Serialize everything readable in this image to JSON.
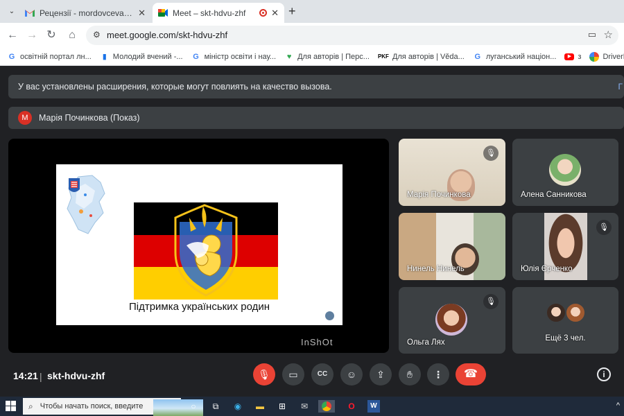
{
  "browser": {
    "tabs": [
      {
        "title": "Рецензії - mordovcevanv@gma",
        "active": false
      },
      {
        "title": "Meet – skt-hdvu-zhf",
        "active": true
      }
    ],
    "url": "meet.google.com/skt-hdvu-zhf",
    "bookmarks": [
      {
        "label": "освітній портал лн...",
        "icon": "google-g-icon"
      },
      {
        "label": "Молодий вчений -...",
        "icon": "bookmark-icon"
      },
      {
        "label": "міністр освіти і нау...",
        "icon": "google-g-icon"
      },
      {
        "label": "Для авторів | Перс...",
        "icon": "heart-icon"
      },
      {
        "label": "Для авторів | Věda...",
        "icon": "pkf-icon"
      },
      {
        "label": "луганський націон...",
        "icon": "google-g-icon"
      },
      {
        "label": "з",
        "icon": "youtube-icon"
      },
      {
        "label": "DriverPack",
        "icon": "driverpack-icon"
      }
    ]
  },
  "meet": {
    "banner": "У вас установлены расширения, которые могут повлиять на качество вызова.",
    "banner_more": "Г",
    "presenter": {
      "avatar_letter": "М",
      "name": "Марія Починкова (Показ)"
    },
    "slide": {
      "caption": "Підтримка українських родин",
      "watermark": "InShOt"
    },
    "participants": [
      {
        "name": "Марія Починкова",
        "muted": true
      },
      {
        "name": "Алена Санникова",
        "muted": false
      },
      {
        "name": "Нинель Нинель",
        "muted": false
      },
      {
        "name": "Юлія Єрченко",
        "muted": true
      },
      {
        "name": "Ольга Лях",
        "muted": true
      },
      {
        "name": "Ещё 3 чел.",
        "muted": false
      }
    ],
    "footer": {
      "time": "14:21",
      "separator": "|",
      "meeting_code": "skt-hdvu-zhf"
    }
  },
  "taskbar": {
    "search_placeholder": "Чтобы начать поиск, введите"
  },
  "colors": {
    "meet_bg": "#202124",
    "tile_bg": "#3c4043",
    "hangup_red": "#ea4335",
    "flag_black": "#000000",
    "flag_red": "#dd0000",
    "flag_gold": "#ffce00"
  }
}
